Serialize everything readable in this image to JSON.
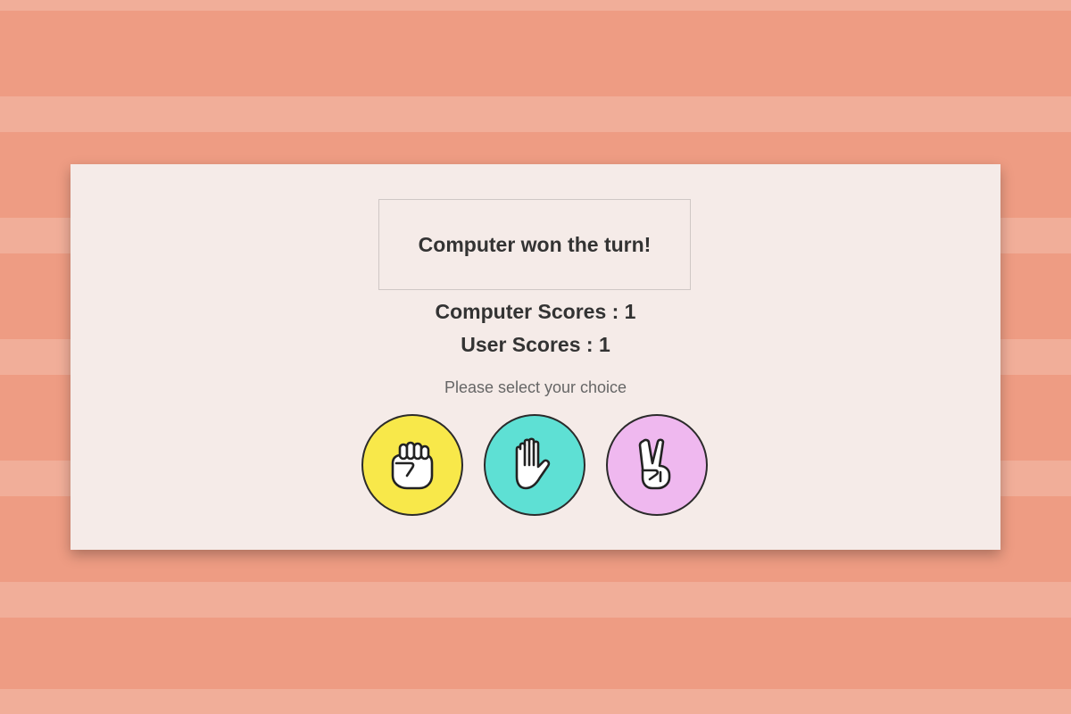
{
  "game": {
    "result_message": "Computer won the turn!",
    "computer_score_text": "Computer Scores : 1",
    "user_score_text": "User Scores : 1",
    "prompt": "Please select your choice"
  },
  "choices": [
    {
      "name": "rock",
      "icon": "fist-icon",
      "color": "#f8e84a"
    },
    {
      "name": "paper",
      "icon": "open-hand-icon",
      "color": "#5ee0d4"
    },
    {
      "name": "scissors",
      "icon": "victory-hand-icon",
      "color": "#efb8ef"
    }
  ],
  "colors": {
    "background": "#ee9c83",
    "card": "#f5ebe8",
    "text": "#333333"
  }
}
